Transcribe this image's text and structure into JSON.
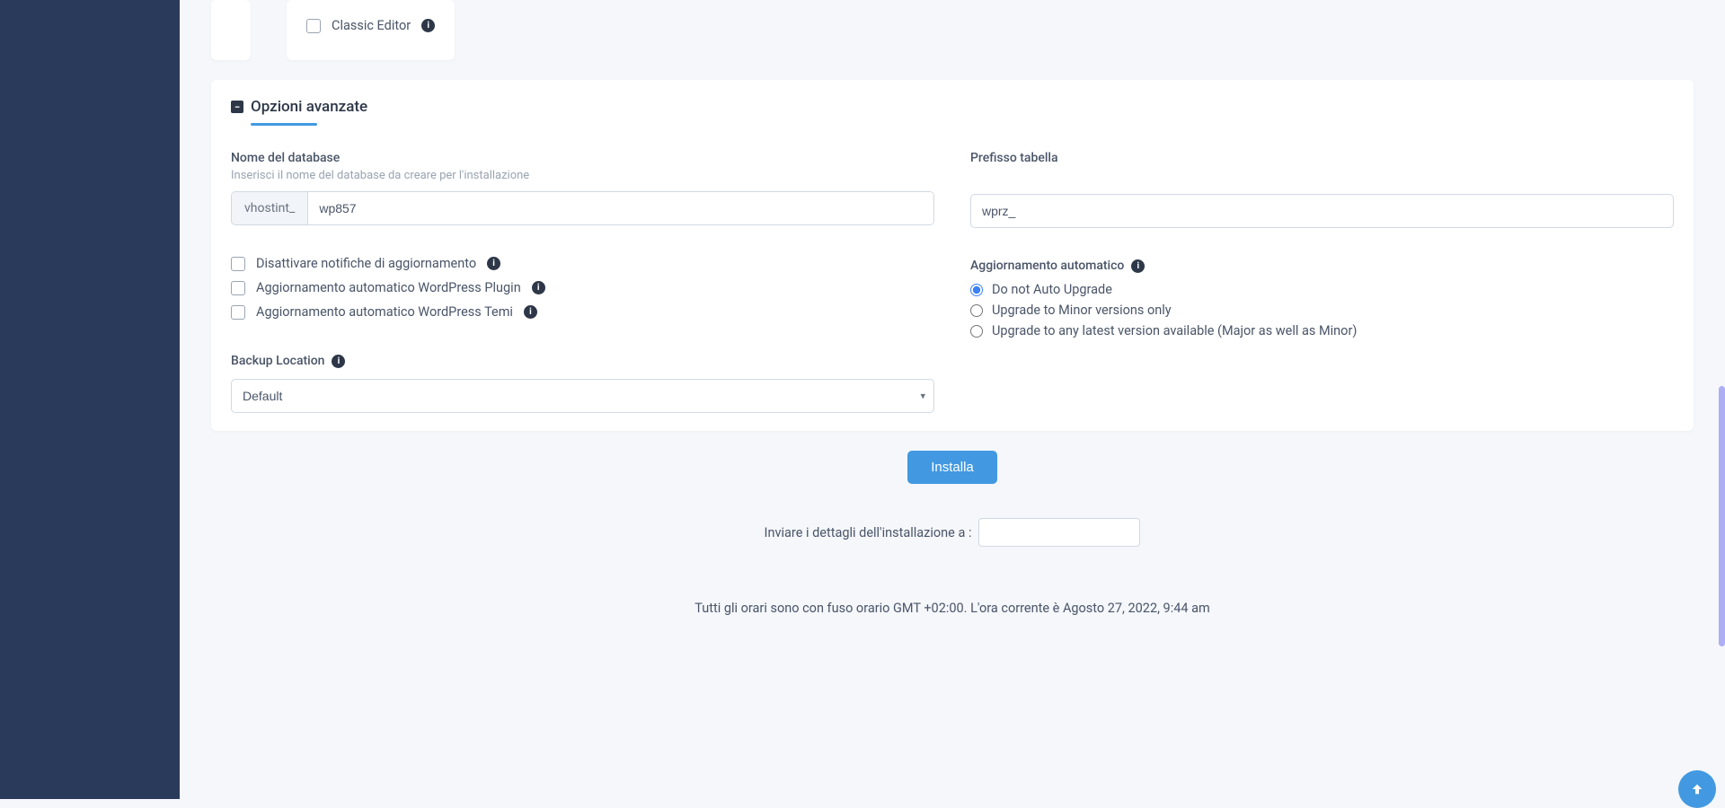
{
  "top_right": {
    "classic_editor_label": "Classic Editor"
  },
  "advanced": {
    "title": "Opzioni avanzate",
    "database": {
      "label": "Nome del database",
      "sub": "Inserisci il nome del database da creare per l'installazione",
      "prefix": "vhostint_",
      "value": "wp857"
    },
    "table_prefix": {
      "label": "Prefisso tabella",
      "value": "wprz_"
    },
    "checkboxes": {
      "disable_updates": "Disattivare notifiche di aggiornamento",
      "auto_plugin": "Aggiornamento automatico WordPress Plugin",
      "auto_theme": "Aggiornamento automatico WordPress Temi"
    },
    "auto_upgrade": {
      "label": "Aggiornamento automatico",
      "options": {
        "none": "Do not Auto Upgrade",
        "minor": "Upgrade to Minor versions only",
        "major": "Upgrade to any latest version available (Major as well as Minor)"
      }
    },
    "backup": {
      "label": "Backup Location",
      "selected": "Default"
    }
  },
  "actions": {
    "install": "Installa",
    "email_label": "Inviare i dettagli dell'installazione a :"
  },
  "footer": {
    "text": "Tutti gli orari sono con fuso orario GMT +02:00. L'ora corrente è Agosto 27, 2022, 9:44 am"
  }
}
